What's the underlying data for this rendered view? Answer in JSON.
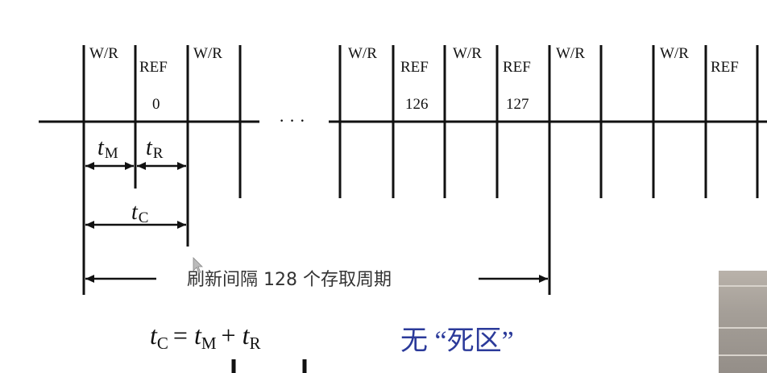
{
  "labels": {
    "wr": "W/R",
    "ref": "REF",
    "ref_index_first": "0",
    "ref_index_126": "126",
    "ref_index_127": "127",
    "ellipsis": "· · ·",
    "t_m": "t",
    "t_m_sub": "M",
    "t_r": "t",
    "t_r_sub": "R",
    "t_c": "t",
    "t_c_sub": "C",
    "interval": "刷新间隔  128 个存取周期",
    "no_dead_zone": "无 “死区”"
  },
  "formula": {
    "lhs": "t",
    "lhs_sub": "C",
    "eq": "=",
    "a": "t",
    "a_sub": "M",
    "plus": "+",
    "b": "t",
    "b_sub": "R"
  },
  "colors": {
    "ink": "#111111",
    "accent": "#2b3a9a"
  }
}
